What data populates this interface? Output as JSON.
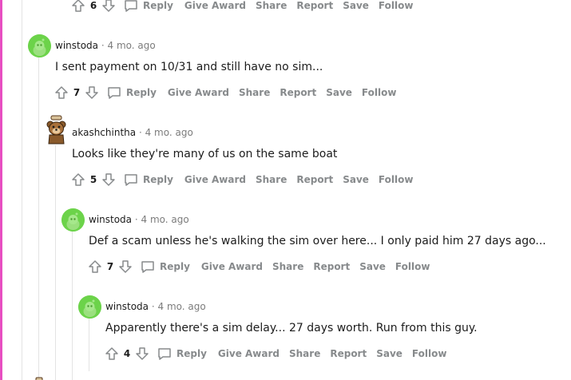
{
  "actions": {
    "reply": "Reply",
    "give_award": "Give Award",
    "share": "Share",
    "report": "Report",
    "save": "Save",
    "follow": "Follow"
  },
  "colors": {
    "accent_bar": "#e74ec1",
    "avatar_green": "#6cd34a",
    "meta_gray": "#7c7c7c",
    "action_gray": "#878a8c"
  },
  "comments": [
    {
      "score": "6"
    },
    {
      "username": "winstoda",
      "separator": "·",
      "time": "4 mo. ago",
      "body": "I sent payment on 10/31 and still have no sim...",
      "score": "7",
      "avatar": "green-snoo"
    },
    {
      "username": "akashchintha",
      "separator": "·",
      "time": "4 mo. ago",
      "body": "Looks like they're many of us on the same boat",
      "score": "5",
      "avatar": "bear"
    },
    {
      "username": "winstoda",
      "separator": "·",
      "time": "4 mo. ago",
      "body": "Def a scam unless he's walking the sim over here... I only paid him 27 days ago...",
      "score": "7",
      "avatar": "green-snoo"
    },
    {
      "username": "winstoda",
      "separator": "·",
      "time": "4 mo. ago",
      "body": "Apparently there's a sim delay... 27 days worth. Run from this guy.",
      "score": "4",
      "avatar": "green-snoo"
    }
  ]
}
